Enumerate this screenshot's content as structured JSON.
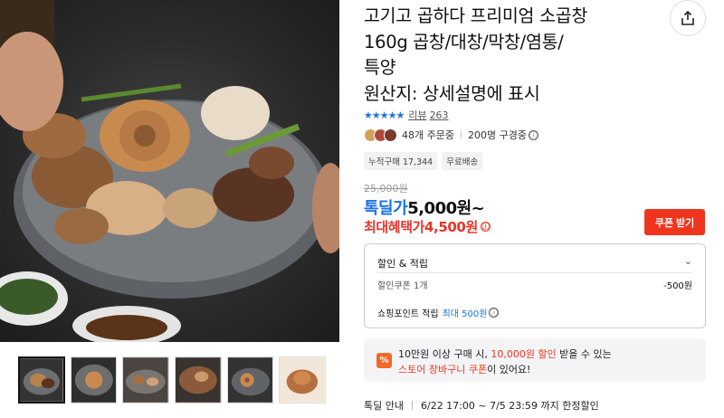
{
  "product": {
    "title_line1": "고기고 곱하다 프리미엄 소곱창",
    "title_line2": "160g 곱창/대창/막창/염통/",
    "title_line3": "특양",
    "title_line4": "원산지: 상세설명에 표시"
  },
  "rating": {
    "stars": "★★★★★",
    "label": "리뷰",
    "count": "263"
  },
  "orders": {
    "orders_text": "48개 주문중",
    "subscribers_text": "200명 구경중",
    "info_icon": "ⓘ"
  },
  "tags": [
    "누적구매 17,344",
    "무료배송"
  ],
  "price": {
    "original": "25,000원",
    "deal_label": "톡딜가",
    "deal_value": "5,000원~",
    "max_label": "최대혜택가",
    "max_value": "4,500원",
    "coupon_button": "쿠폰 받기"
  },
  "discount": {
    "header": "할인 & 적립",
    "chevron": "⌄",
    "coupon_label": "할인쿠폰 1개",
    "coupon_value": "-500원",
    "points_label": "쇼핑포인트 적립",
    "points_value": "최대 500원"
  },
  "promo": {
    "icon": "%",
    "line1_a": "10만원 이상 구매 시, ",
    "line1_b": "10,000원 할인",
    "line1_c": " 받을 수 있는",
    "line2_a": "스토어 장바구니 쿠폰",
    "line2_b": "이 있어요!"
  },
  "deal_info": {
    "label": "톡딜 안내",
    "text": "6/22 17:00 ~ 7/5 23:59 까지 한정할인"
  },
  "icons": {
    "share": "share-icon"
  },
  "colors": {
    "accent_blue": "#1a73e8",
    "accent_red": "#f0351f",
    "promo_orange": "#f06a2a"
  }
}
